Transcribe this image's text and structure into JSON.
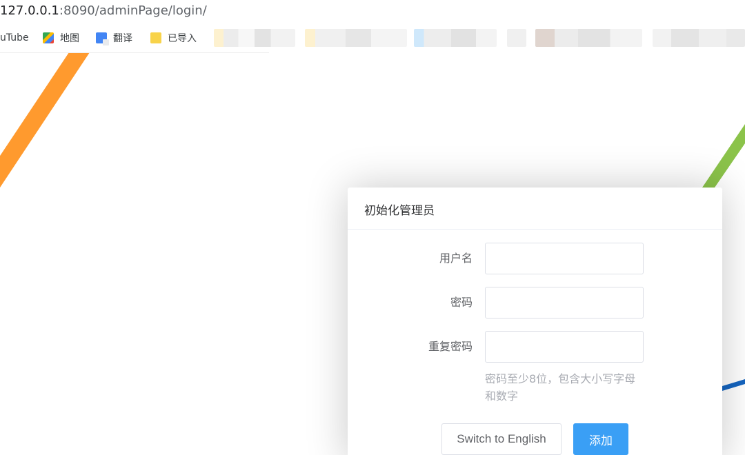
{
  "browser": {
    "url_host": "127.0.0.1",
    "url_path": ":8090/adminPage/login/",
    "bookmarks": [
      {
        "label": "uTube",
        "icon": "youtube-icon"
      },
      {
        "label": "地图",
        "icon": "maps-icon"
      },
      {
        "label": "翻译",
        "icon": "translate-icon"
      },
      {
        "label": "已导入",
        "icon": "folder-icon"
      }
    ]
  },
  "dialog": {
    "title": "初始化管理员",
    "fields": [
      {
        "label": "用户名",
        "value": "",
        "placeholder": ""
      },
      {
        "label": "密码",
        "value": "",
        "placeholder": ""
      },
      {
        "label": "重复密码",
        "value": "",
        "placeholder": ""
      }
    ],
    "hint": "密码至少8位，包含大小写字母和数字",
    "switch_button": "Switch to English",
    "submit_button": "添加"
  },
  "colors": {
    "primary": "#3a9ff5",
    "deco_orange": "#ff9a2e",
    "deco_green": "#8bc34a",
    "deco_blue": "#1565c0"
  }
}
